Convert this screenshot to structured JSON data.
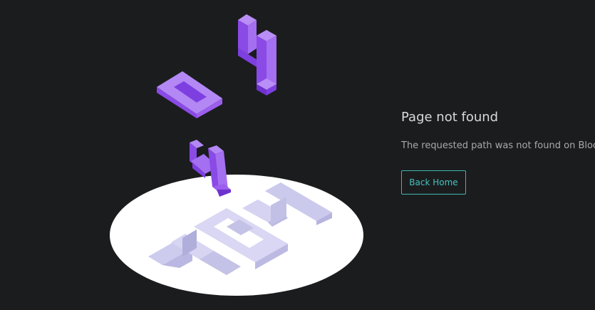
{
  "error": {
    "title": "Page not found",
    "description": "The requested path was not found on Block",
    "back_button_label": "Back Home"
  },
  "illustration": {
    "text": "404"
  },
  "colors": {
    "background": "#1b1c1e",
    "accent": "#46c2bf",
    "digit_purple_top": "#b388f5",
    "digit_purple_side": "#7e3fe0",
    "shadow_digit": "#c4c2e6"
  }
}
